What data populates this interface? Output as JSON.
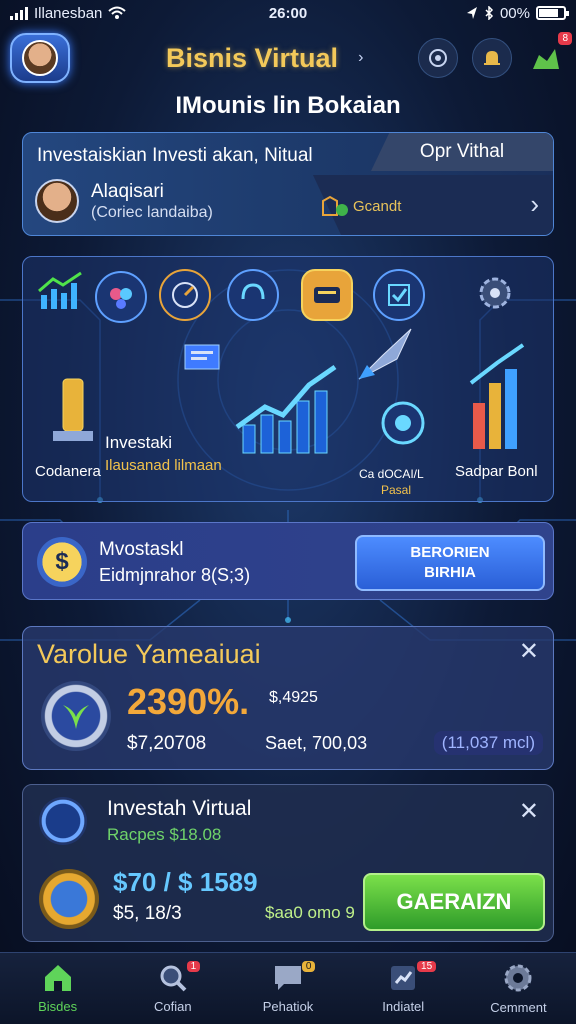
{
  "status_bar": {
    "carrier": "Illanesban",
    "time": "26:00",
    "battery": "00%"
  },
  "header": {
    "title": "Bisnis Virtual",
    "notif_count": "8"
  },
  "subheading": "IMounis lin Bokaian",
  "account_card": {
    "headline": "Investaiskian Investi akan, Nitual",
    "tab_label": "Opr Vithal",
    "name": "Alaqisari",
    "subtitle": "(Coriec landaiba)",
    "badge_text": "Gcandt"
  },
  "dashboard": {
    "label_left": "Codanera",
    "label_invest": "Investaki",
    "label_invest_sub": "Ilausanad lilmaan",
    "label_center": "Ca dOCAI/L",
    "label_center_sub": "Pasal",
    "label_right": "Sadpar Bonl"
  },
  "invest_card": {
    "title": "Mvostaskl",
    "subtitle": "Eidmjnrahor 8(S;3)",
    "button_line1": "BERORIEN",
    "button_line2": "BIRHIA"
  },
  "stats_card": {
    "title": "Varolue Yameaiuai",
    "percent": "2390%.",
    "percent_side": "$,4925",
    "value_a": "$7,20708",
    "value_b": "Saet, 700,03",
    "pill": "(11,037 mcl)"
  },
  "virtual_card": {
    "title": "Investah Virtual",
    "subtitle": "Racpes $18.08",
    "value_big": "$70 / $ 1589",
    "value_small": "$5, 18/3",
    "value_green": "$aa0 omo 9",
    "button_label": "GAERAIZN"
  },
  "bottom_nav": [
    {
      "label": "Bisdes",
      "icon": "home-icon",
      "badge": ""
    },
    {
      "label": "Cofian",
      "icon": "search-icon",
      "badge": "1"
    },
    {
      "label": "Pehatiok",
      "icon": "chat-icon",
      "badge": "0"
    },
    {
      "label": "Indiatel",
      "icon": "stats-icon",
      "badge": "15"
    },
    {
      "label": "Cemment",
      "icon": "settings-icon",
      "badge": ""
    }
  ],
  "colors": {
    "accent_gold": "#f3c95a",
    "accent_green": "#5fd45a",
    "accent_blue": "#4d8cff"
  }
}
